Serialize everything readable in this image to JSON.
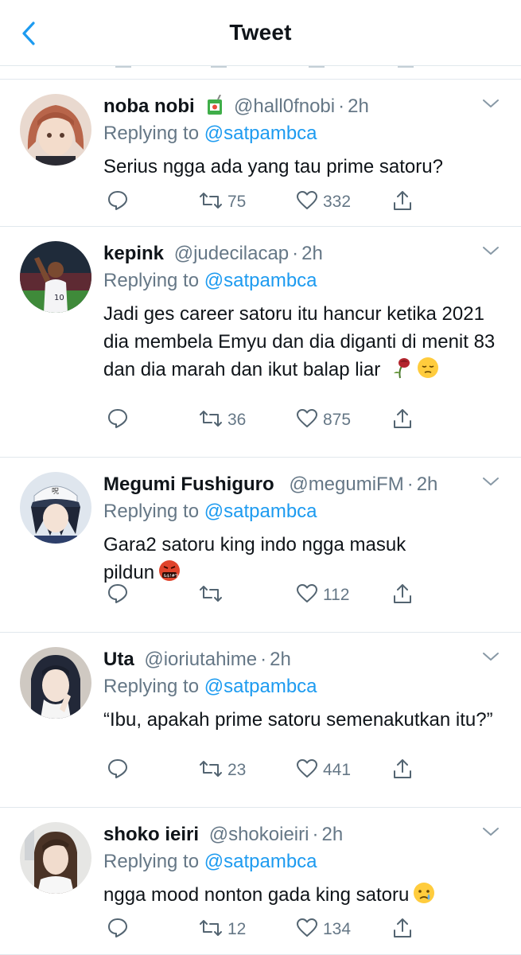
{
  "header": {
    "title": "Tweet"
  },
  "tweets": [
    {
      "name": "noba nobi",
      "handle": "@hall0fnobi",
      "time": "2h",
      "replying_prefix": "Replying to",
      "replying_to": "@satpambca",
      "text": "Serius ngga ada yang tau prime satoru?",
      "retweets": "75",
      "likes": "332",
      "name_emoji": "juice-box-emoji"
    },
    {
      "name": "kepink",
      "handle": "@judecilacap",
      "time": "2h",
      "replying_prefix": "Replying to",
      "replying_to": "@satpambca",
      "text": "Jadi ges career satoru itu hancur ketika 2021 dia membela Emyu dan dia diganti di menit 83 dan dia marah dan ikut balap liar",
      "text_emojis": [
        "wilted-flower-emoji",
        "pensive-face-emoji"
      ],
      "retweets": "36",
      "likes": "875"
    },
    {
      "name": "Megumi Fushiguro",
      "handle": "@megumiFM",
      "time": "2h",
      "replying_prefix": "Replying to",
      "replying_to": "@satpambca",
      "text": "Gara2 satoru king indo ngga masuk pildun",
      "text_emojis": [
        "face-with-symbols-on-mouth-emoji"
      ],
      "retweets": "",
      "likes": "112"
    },
    {
      "name": "Uta",
      "handle": "@ioriutahime",
      "time": "2h",
      "replying_prefix": "Replying to",
      "replying_to": "@satpambca",
      "text": "“Ibu, apakah prime satoru semenakutkan itu?”",
      "retweets": "23",
      "likes": "441"
    },
    {
      "name": "shoko ieiri",
      "handle": "@shokoieiri",
      "time": "2h",
      "replying_prefix": "Replying to",
      "replying_to": "@satpambca",
      "text": "ngga mood nonton gada king satoru",
      "text_emojis": [
        "crying-face-emoji"
      ],
      "retweets": "12",
      "likes": "134"
    }
  ],
  "colors": {
    "accent": "#1d9bf0",
    "muted": "#657786",
    "divider": "#e1e8ed",
    "text": "#0f1419"
  }
}
